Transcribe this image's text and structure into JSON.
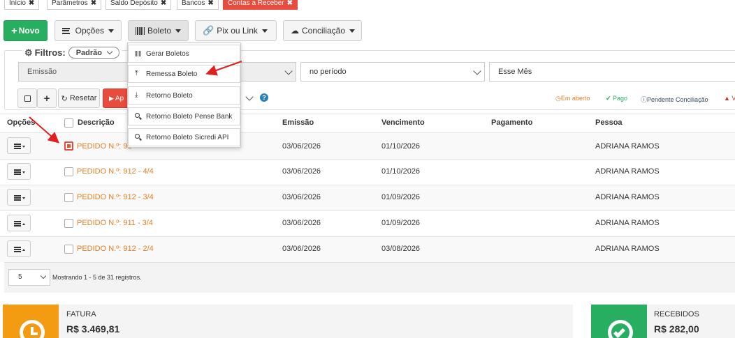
{
  "tabs": [
    {
      "label": "Início"
    },
    {
      "label": "Parâmetros"
    },
    {
      "label": "Saldo Depósito"
    },
    {
      "label": "Bancos"
    },
    {
      "label": "Contas a Receber"
    }
  ],
  "toolbar": {
    "novo": "Novo",
    "opcoes": "Opções",
    "boleto": "Boleto",
    "pix": "Pix ou Link",
    "conciliacao": "Conciliação"
  },
  "boleto_menu": [
    {
      "label": "Gerar Boletos"
    },
    {
      "label": "Remessa Boleto"
    },
    {
      "label": "Retorno Boleto"
    },
    {
      "label": "Retorno Boleto Pense Bank"
    },
    {
      "label": "Retorno Boleto Sicredi API"
    }
  ],
  "filters": {
    "title": "Filtros:",
    "preset": "Padrão",
    "field1": "Emissão",
    "field2": "no período",
    "field3": "Esse Mês",
    "reset": "Resetar",
    "apply_partial": "Ap"
  },
  "legend": [
    {
      "label": "Em aberto",
      "color": "#e67e22"
    },
    {
      "label": "Pago",
      "color": "#27ae60"
    },
    {
      "label": "Pendente Conciliação",
      "color": "#34495e"
    },
    {
      "label": "V",
      "color": "#c0392b"
    }
  ],
  "table": {
    "headers": [
      "Opções",
      "Descrição",
      "Emissão",
      "Vencimento",
      "Pagamento",
      "Pessoa"
    ],
    "rows": [
      {
        "desc": "PEDIDO N.º: 91",
        "emissao": "03/06/2026",
        "vencimento": "01/10/2026",
        "pagamento": "",
        "pessoa": "ADRIANA RAMOS"
      },
      {
        "desc": "PEDIDO N.º: 912 - 4/4",
        "emissao": "03/06/2026",
        "vencimento": "01/10/2026",
        "pagamento": "",
        "pessoa": "ADRIANA RAMOS"
      },
      {
        "desc": "PEDIDO N.º: 912 - 3/4",
        "emissao": "03/06/2026",
        "vencimento": "01/09/2026",
        "pagamento": "",
        "pessoa": "ADRIANA RAMOS"
      },
      {
        "desc": "PEDIDO N.º: 911 - 3/4",
        "emissao": "03/06/2026",
        "vencimento": "01/09/2026",
        "pagamento": "",
        "pessoa": "ADRIANA RAMOS"
      },
      {
        "desc": "PEDIDO N.º: 912 - 2/4",
        "emissao": "03/06/2026",
        "vencimento": "03/08/2026",
        "pagamento": "",
        "pessoa": "ADRIANA RAMOS"
      }
    ]
  },
  "pagination": {
    "page_size": "5",
    "info": "Mostrando 1 - 5 de 31 registros."
  },
  "cards": {
    "fatura_label": "FATURA",
    "fatura_value": "R$ 3.469,81",
    "fatura_color": "#f39c12",
    "recebidos_label": "RECEBIDOS",
    "recebidos_value": "R$ 282,00",
    "recebidos_color": "#27ae60"
  },
  "colors": {
    "accent_red": "#e74c3c",
    "link_orange": "#e67e22",
    "green": "#27ae60"
  }
}
